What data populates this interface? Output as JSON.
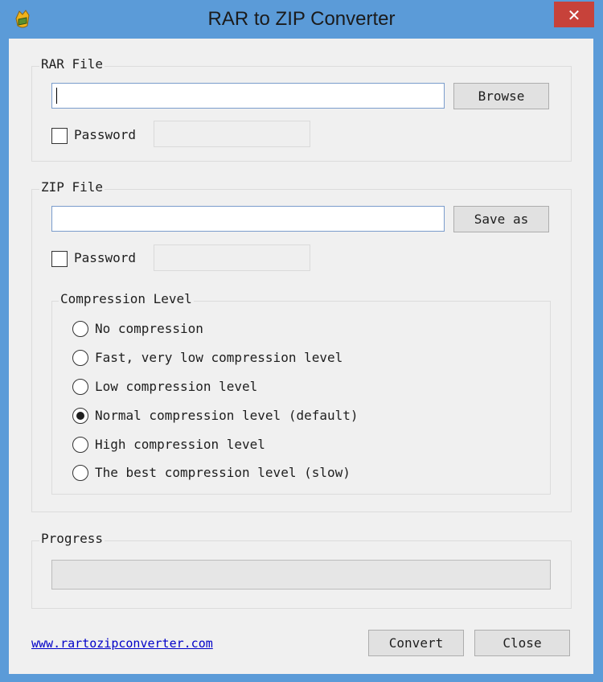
{
  "window": {
    "title": "RAR to ZIP Converter",
    "close_glyph": "✕",
    "app_icon": "hand-archive-icon"
  },
  "rar_file": {
    "group_label": "RAR File",
    "path_value": "",
    "browse_label": "Browse",
    "password_label": "Password",
    "password_checked": false,
    "password_value": ""
  },
  "zip_file": {
    "group_label": "ZIP File",
    "path_value": "",
    "save_as_label": "Save as",
    "password_label": "Password",
    "password_checked": false,
    "password_value": ""
  },
  "compression": {
    "group_label": "Compression Level",
    "options": [
      {
        "label": "No compression",
        "selected": false
      },
      {
        "label": "Fast, very low compression level",
        "selected": false
      },
      {
        "label": "Low compression level",
        "selected": false
      },
      {
        "label": "Normal compression level (default)",
        "selected": true
      },
      {
        "label": "High compression level",
        "selected": false
      },
      {
        "label": "The best compression level (slow)",
        "selected": false
      }
    ]
  },
  "progress": {
    "group_label": "Progress",
    "value": 0
  },
  "footer": {
    "website_link": "www.rartozipconverter.com",
    "convert_label": "Convert",
    "close_label": "Close"
  },
  "colors": {
    "titlebar": "#5b9bd8",
    "close_button": "#c7423a",
    "link": "#0000c8"
  }
}
